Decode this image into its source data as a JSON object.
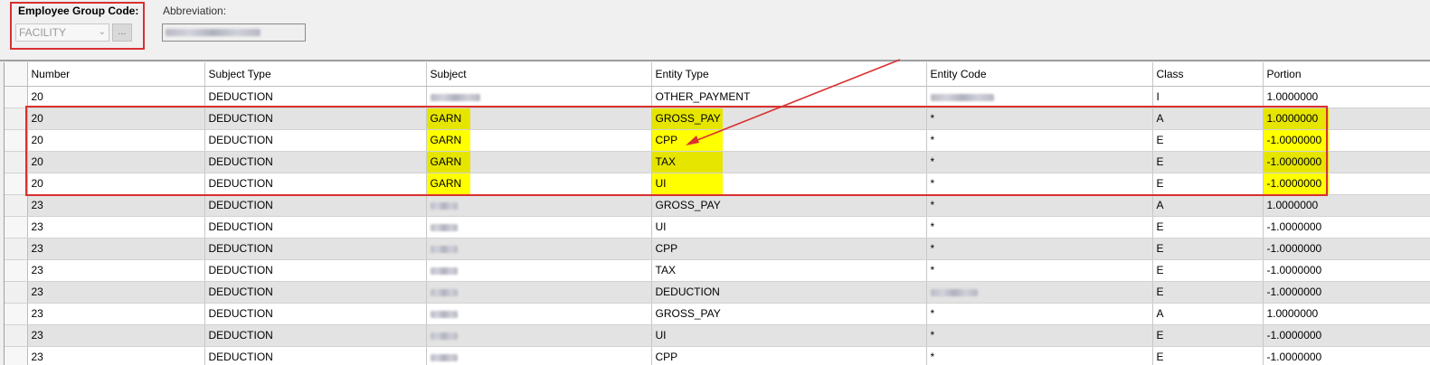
{
  "filters": {
    "employee_group_code_label": "Employee Group Code:",
    "employee_group_code_value": "FACILITY",
    "lookup_button_label": "...",
    "abbreviation_label": "Abbreviation:"
  },
  "table": {
    "columns": [
      "Number",
      "Subject Type",
      "Subject",
      "Entity Type",
      "Entity Code",
      "Class",
      "Portion"
    ],
    "rows": [
      {
        "number": "20",
        "subject_type": "DEDUCTION",
        "subject": "",
        "entity_type": "OTHER_PAYMENT",
        "entity_code": "",
        "class": "I",
        "portion": "1.0000000"
      },
      {
        "number": "20",
        "subject_type": "DEDUCTION",
        "subject": "GARN",
        "entity_type": "GROSS_PAY",
        "entity_code": "*",
        "class": "A",
        "portion": "1.0000000"
      },
      {
        "number": "20",
        "subject_type": "DEDUCTION",
        "subject": "GARN",
        "entity_type": "CPP",
        "entity_code": "*",
        "class": "E",
        "portion": "-1.0000000"
      },
      {
        "number": "20",
        "subject_type": "DEDUCTION",
        "subject": "GARN",
        "entity_type": "TAX",
        "entity_code": "*",
        "class": "E",
        "portion": "-1.0000000"
      },
      {
        "number": "20",
        "subject_type": "DEDUCTION",
        "subject": "GARN",
        "entity_type": "UI",
        "entity_code": "*",
        "class": "E",
        "portion": "-1.0000000"
      },
      {
        "number": "23",
        "subject_type": "DEDUCTION",
        "subject": "",
        "entity_type": "GROSS_PAY",
        "entity_code": "*",
        "class": "A",
        "portion": "1.0000000"
      },
      {
        "number": "23",
        "subject_type": "DEDUCTION",
        "subject": "",
        "entity_type": "UI",
        "entity_code": "*",
        "class": "E",
        "portion": "-1.0000000"
      },
      {
        "number": "23",
        "subject_type": "DEDUCTION",
        "subject": "",
        "entity_type": "CPP",
        "entity_code": "*",
        "class": "E",
        "portion": "-1.0000000"
      },
      {
        "number": "23",
        "subject_type": "DEDUCTION",
        "subject": "",
        "entity_type": "TAX",
        "entity_code": "*",
        "class": "E",
        "portion": "-1.0000000"
      },
      {
        "number": "23",
        "subject_type": "DEDUCTION",
        "subject": "",
        "entity_type": "DEDUCTION",
        "entity_code": "",
        "class": "E",
        "portion": "-1.0000000"
      },
      {
        "number": "23",
        "subject_type": "DEDUCTION",
        "subject": "",
        "entity_type": "GROSS_PAY",
        "entity_code": "*",
        "class": "A",
        "portion": "1.0000000"
      },
      {
        "number": "23",
        "subject_type": "DEDUCTION",
        "subject": "",
        "entity_type": "UI",
        "entity_code": "*",
        "class": "E",
        "portion": "-1.0000000"
      },
      {
        "number": "23",
        "subject_type": "DEDUCTION",
        "subject": "",
        "entity_type": "CPP",
        "entity_code": "*",
        "class": "E",
        "portion": "-1.0000000"
      }
    ]
  },
  "colors": {
    "highlight": "#ffff00",
    "annotation": "#d93030",
    "alt_row": "#e3e3e3"
  }
}
